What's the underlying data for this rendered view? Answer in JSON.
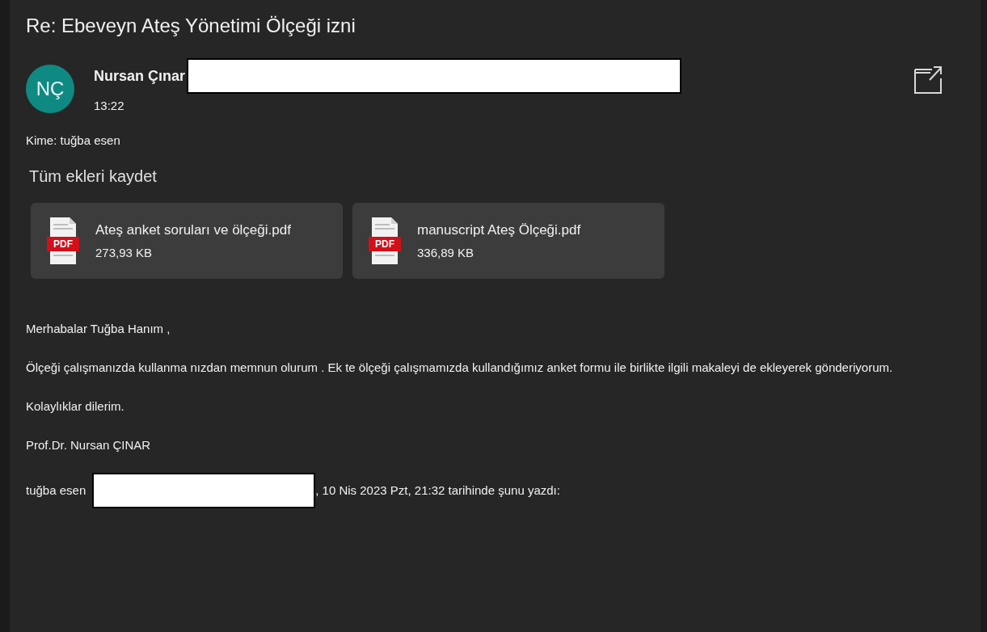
{
  "subject": "Re: Ebeveyn Ateş Yönetimi Ölçeği izni",
  "sender": {
    "initials": "NÇ",
    "name": "Nursan Çınar",
    "time": "13:22"
  },
  "recipient": "Kime: tuğba esen",
  "save_all": "Tüm ekleri kaydet",
  "attachments": [
    {
      "icon_label": "PDF",
      "name": "Ateş anket soruları ve ölçeği.pdf",
      "size": "273,93 KB"
    },
    {
      "icon_label": "PDF",
      "name": "manuscript Ateş Ölçeği.pdf",
      "size": "336,89 KB"
    }
  ],
  "body": [
    "Merhabalar Tuğba Hanım ,",
    "Ölçeği çalışmanızda kullanma nızdan memnun olurum . Ek te ölçeği çalışmamızda kullandığımız anket formu ile birlikte ilgili makaleyi de ekleyerek gönderiyorum.",
    "Kolaylıklar dilerim.",
    "Prof.Dr. Nursan ÇINAR"
  ],
  "quote_header": {
    "before": "tuğba esen",
    "after": ", 10 Nis 2023 Pzt, 21:32 tarihinde şunu yazdı:"
  }
}
